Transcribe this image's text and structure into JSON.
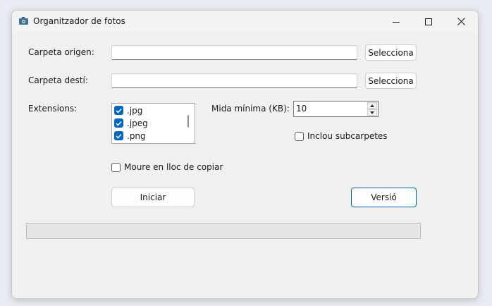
{
  "window": {
    "title": "Organitzador de fotos",
    "icon": "camera-icon",
    "controls": {
      "minimize": "minimize-icon",
      "maximize": "maximize-icon",
      "close": "close-icon"
    }
  },
  "form": {
    "source_label": "Carpeta origen:",
    "source_value": "",
    "source_button": "Selecciona",
    "dest_label": "Carpeta destí:",
    "dest_value": "",
    "dest_button": "Selecciona",
    "extensions_label": "Extensions:",
    "extensions": [
      {
        "label": ".jpg",
        "checked": true
      },
      {
        "label": ".jpeg",
        "checked": true
      },
      {
        "label": ".png",
        "checked": true
      }
    ],
    "min_size_label": "Mida mínima (KB):",
    "min_size_value": "10",
    "include_subfolders_label": "Inclou subcarpetes",
    "include_subfolders_checked": false,
    "move_instead_label": "Moure en lloc de copiar",
    "move_instead_checked": false,
    "start_button": "Iniciar",
    "version_button": "Versió",
    "progress": 0
  },
  "colors": {
    "accent": "#0067c0",
    "window_bg": "#f0f0f0",
    "desktop_bg": "#e9ecf2"
  }
}
